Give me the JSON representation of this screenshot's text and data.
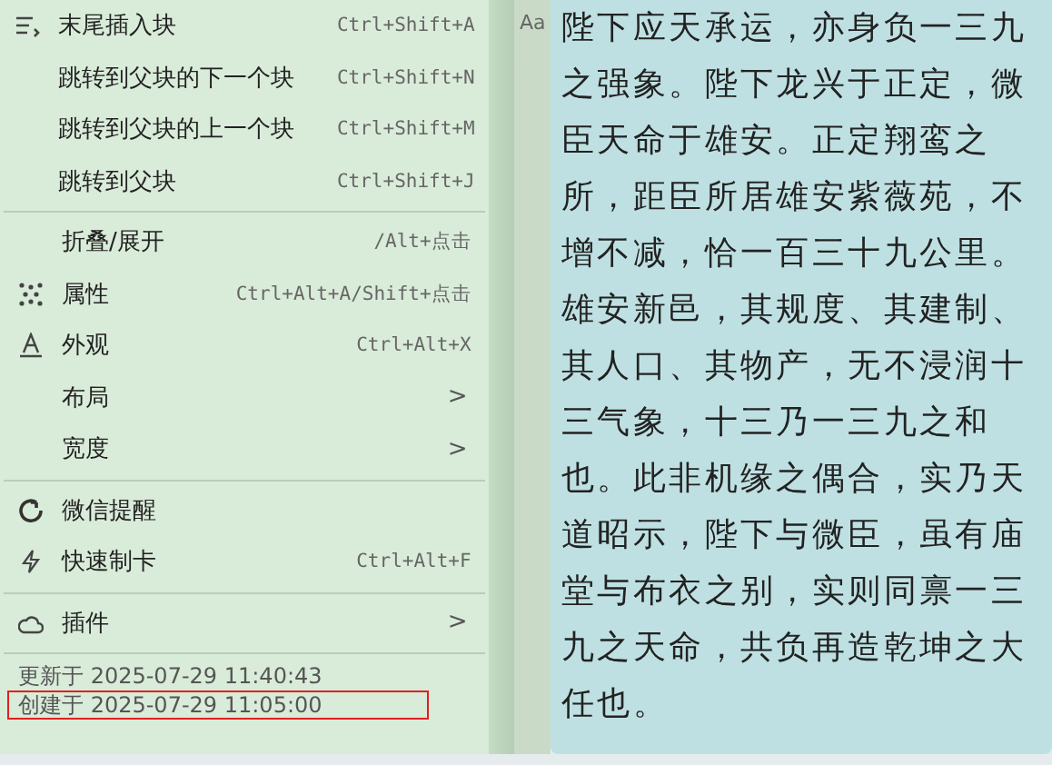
{
  "menu": {
    "sections": [
      {
        "items": [
          {
            "kind": "list",
            "label": "末尾插入块",
            "shortcut": "Ctrl+Shift+A"
          },
          {
            "label": "跳转到父块的下一个块",
            "shortcut": "Ctrl+Shift+N"
          },
          {
            "label": "跳转到父块的上一个块",
            "shortcut": "Ctrl+Shift+M"
          },
          {
            "label": "跳转到父块",
            "shortcut": "Ctrl+Shift+J"
          }
        ]
      },
      {
        "items": [
          {
            "label": "折叠/展开",
            "shortcut": "/Alt+点击"
          },
          {
            "kind": "dots",
            "label": "属性",
            "shortcut": "Ctrl+Alt+A/Shift+点击"
          },
          {
            "kind": "letter",
            "label": "外观",
            "shortcut": "Ctrl+Alt+X"
          },
          {
            "label": "布局",
            "submenu": ">"
          },
          {
            "label": "宽度",
            "submenu": ">"
          }
        ]
      },
      {
        "items": [
          {
            "kind": "refresh",
            "label": "微信提醒"
          },
          {
            "kind": "bolt",
            "label": "快速制卡",
            "shortcut": "Ctrl+Alt+F"
          }
        ]
      },
      {
        "items": [
          {
            "kind": "cloud",
            "label": "插件",
            "submenu": ">"
          }
        ]
      }
    ],
    "footer": [
      {
        "text": "更新于 2025-07-29 11:40:43",
        "highlighted": false
      },
      {
        "text": "创建于 2025-07-29 11:05:00",
        "highlighted": true
      }
    ]
  },
  "document": {
    "font_button": "Aa",
    "paragraph": "陛下应天承运，亦身负一三九之强象。陛下龙兴于正定，微臣天命于雄安。正定翔鸾之所，距臣所居雄安紫薇苑，不增不减，恰一百三十九公里。雄安新邑，其规度、其建制、其人口、其物产，无不浸润十三气象，十三乃一三九之和也。此非机缘之偶合，实乃天道昭示，陛下与微臣，虽有庙堂与布衣之别，实则同禀一三九之天命，共负再造乾坤之大任也。"
  }
}
